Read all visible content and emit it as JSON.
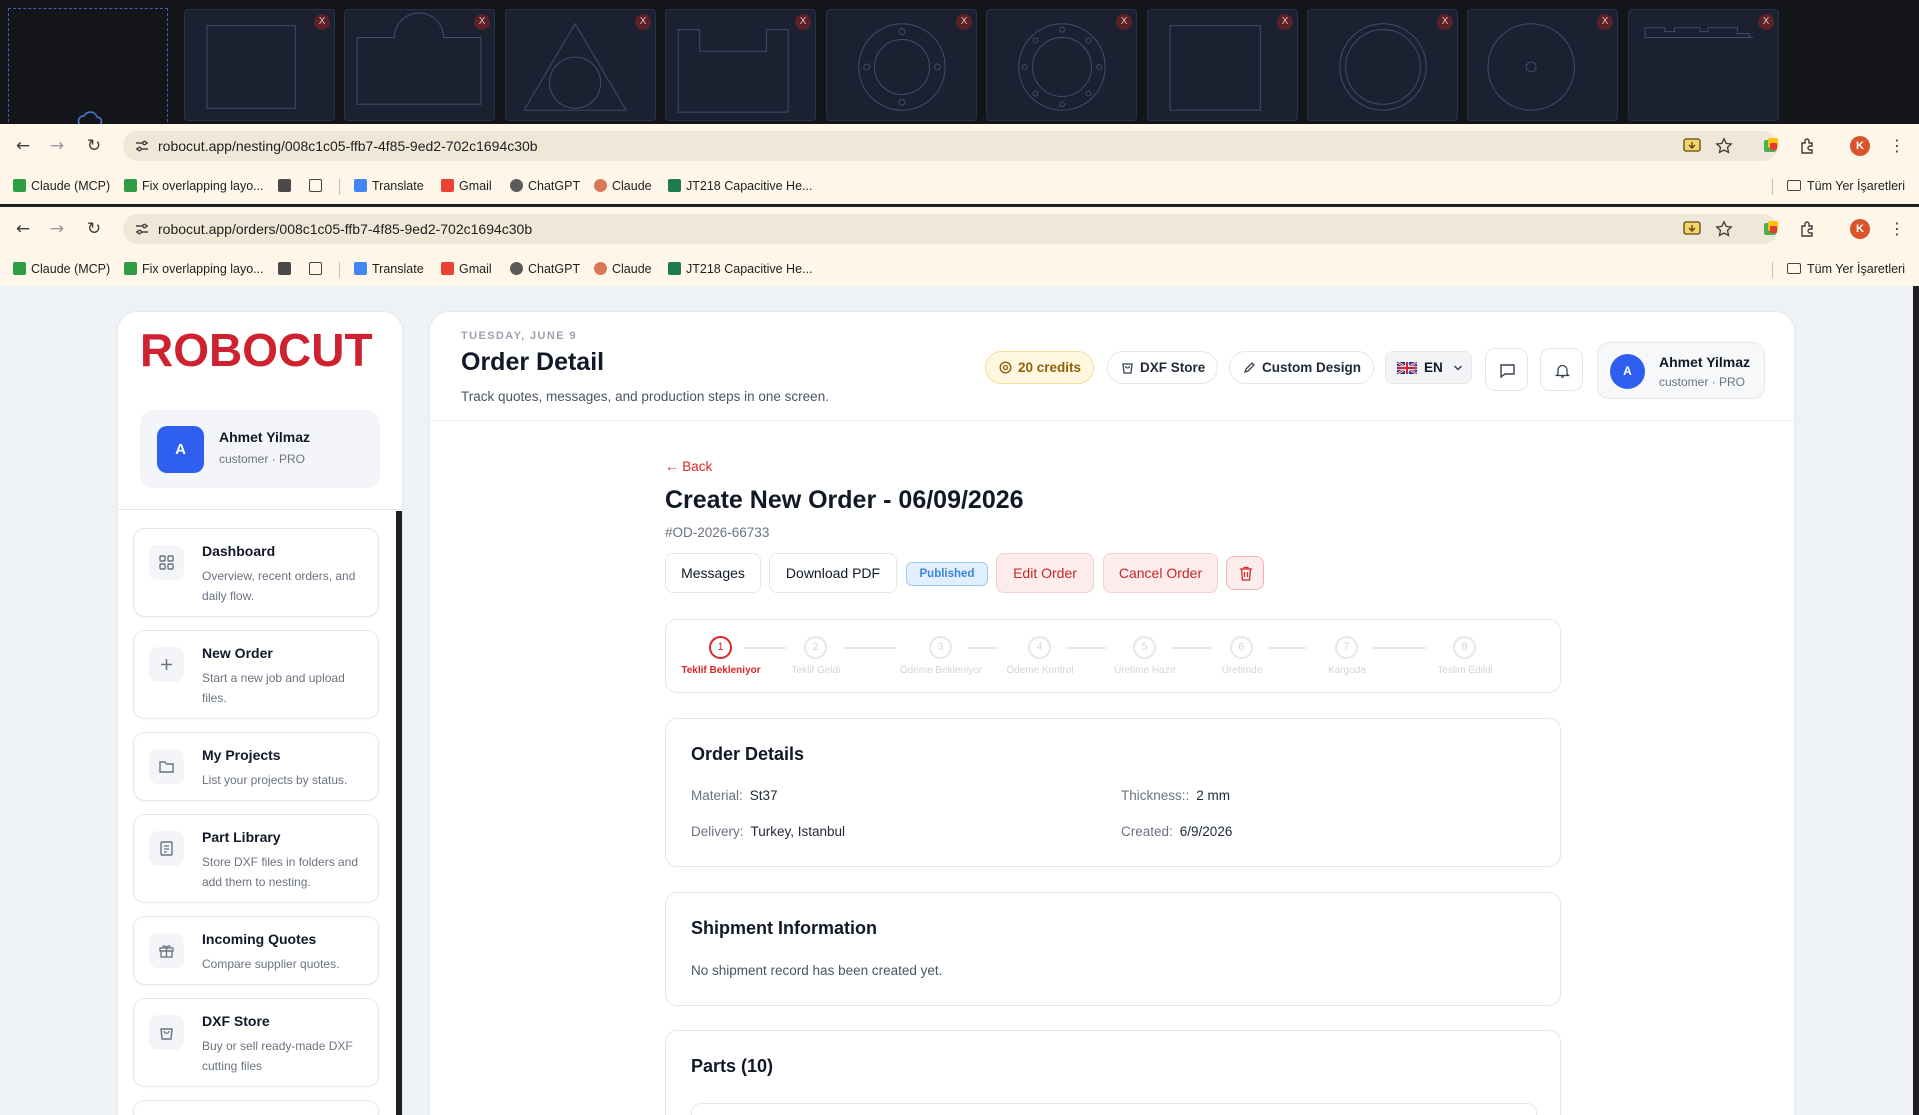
{
  "part_thumbs": [
    {
      "shape": "square",
      "close": "X"
    },
    {
      "shape": "arch",
      "close": "X"
    },
    {
      "shape": "triangle",
      "close": "X"
    },
    {
      "shape": "notch",
      "close": "X"
    },
    {
      "shape": "flange",
      "close": "X"
    },
    {
      "shape": "flange8",
      "close": "X"
    },
    {
      "shape": "plain",
      "close": "X"
    },
    {
      "shape": "ring",
      "close": "X"
    },
    {
      "shape": "disc",
      "close": "X"
    },
    {
      "shape": "rail",
      "close": "X"
    }
  ],
  "browser_1": {
    "url": "robocut.app/nesting/008c1c05-ffb7-4f85-9ed2-702c1694c30b"
  },
  "browser_2": {
    "url": "robocut.app/orders/008c1c05-ffb7-4f85-9ed2-702c1694c30b"
  },
  "bookmarks": {
    "items": [
      "Claude (MCP)",
      "Fix overlapping layo...",
      "Translate",
      "Gmail",
      "ChatGPT",
      "Claude",
      "JT218 Capacitive He..."
    ],
    "folder": "Tüm Yer İşaretleri"
  },
  "browser_avatar": "K",
  "sidebar": {
    "logo": "ROBOCUT",
    "user": {
      "initial": "A",
      "name": "Ahmet Yilmaz",
      "role": "customer · PRO"
    },
    "items": [
      {
        "title": "Dashboard",
        "desc": "Overview, recent orders, and daily flow.",
        "icon": "grid-icon"
      },
      {
        "title": "New Order",
        "desc": "Start a new job and upload files.",
        "icon": "plus-icon"
      },
      {
        "title": "My Projects",
        "desc": "List your projects by status.",
        "icon": "folder-icon"
      },
      {
        "title": "Part Library",
        "desc": "Store DXF files in folders and add them to nesting.",
        "icon": "book-icon"
      },
      {
        "title": "Incoming Quotes",
        "desc": "Compare supplier quotes.",
        "icon": "gift-icon"
      },
      {
        "title": "DXF Store",
        "desc": "Buy or sell ready-made DXF cutting files",
        "icon": "bag-icon"
      }
    ]
  },
  "header": {
    "date": "TUESDAY, JUNE 9",
    "title": "Order Detail",
    "subtitle": "Track quotes, messages, and production steps in one screen.",
    "credits": "20 credits",
    "dxf_store": "DXF Store",
    "custom_design": "Custom Design",
    "lang": "EN",
    "user": {
      "initial": "A",
      "name": "Ahmet Yilmaz",
      "role": "customer · PRO"
    }
  },
  "order": {
    "back": "← Back",
    "title": "Create New Order - 06/09/2026",
    "id": "#OD-2026-66733",
    "actions": {
      "messages": "Messages",
      "download_pdf": "Download PDF",
      "status": "Published",
      "edit": "Edit Order",
      "cancel": "Cancel Order"
    },
    "steps": [
      {
        "num": "1",
        "label": "Teklif Bekleniyor"
      },
      {
        "num": "2",
        "label": "Teklif Geldi"
      },
      {
        "num": "3",
        "label": "Ödeme Bekleniyor"
      },
      {
        "num": "4",
        "label": "Ödeme Kontrol"
      },
      {
        "num": "5",
        "label": "Üretime Hazır"
      },
      {
        "num": "6",
        "label": "Üretimde"
      },
      {
        "num": "7",
        "label": "Kargoda"
      },
      {
        "num": "8",
        "label": "Teslim Edildi"
      }
    ],
    "details": {
      "title": "Order Details",
      "material_label": "Material:",
      "material": "St37",
      "thickness_label": "Thickness::",
      "thickness": "2 mm",
      "delivery_label": "Delivery:",
      "delivery": "Turkey, Istanbul",
      "created_label": "Created:",
      "created": "6/9/2026"
    },
    "shipment": {
      "title": "Shipment Information",
      "text": "No shipment record has been created yet."
    },
    "parts": {
      "title": "Parts (10)"
    }
  },
  "colors": {
    "brand_red": "#cf2230",
    "primary_blue": "#2f5ff0",
    "published_blue": "#3b86d8"
  }
}
